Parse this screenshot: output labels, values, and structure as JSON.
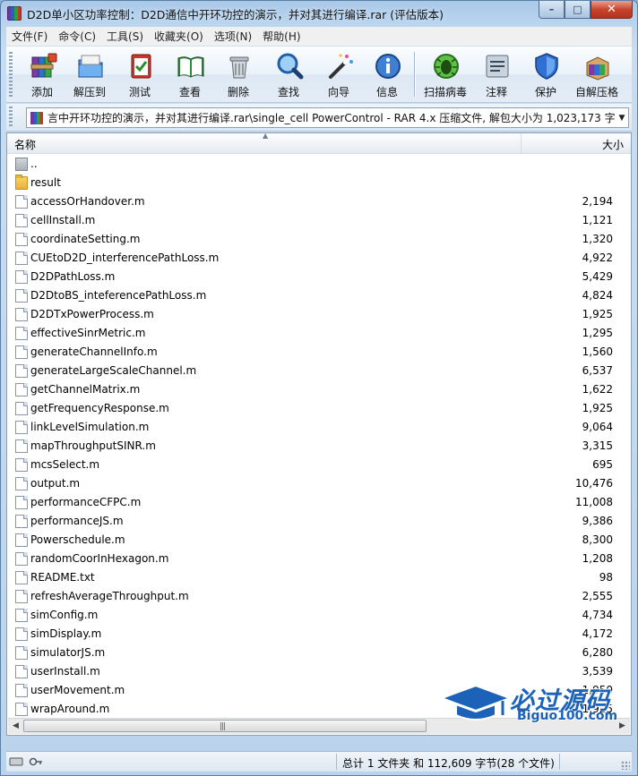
{
  "window": {
    "title": "D2D单小区功率控制：D2D通信中开环功控的演示，并对其进行编译.rar (评估版本)",
    "controls": {
      "minimize": "–",
      "maximize": "□",
      "close": "✕"
    }
  },
  "menu": [
    "文件(F)",
    "命令(C)",
    "工具(S)",
    "收藏夹(O)",
    "选项(N)",
    "帮助(H)"
  ],
  "toolbar": [
    {
      "label": "添加",
      "icon": "add-archive-icon"
    },
    {
      "label": "解压到",
      "icon": "extract-to-icon"
    },
    {
      "label": "测试",
      "icon": "test-icon"
    },
    {
      "label": "查看",
      "icon": "view-icon"
    },
    {
      "label": "删除",
      "icon": "delete-icon"
    },
    {
      "label": "查找",
      "icon": "find-icon"
    },
    {
      "label": "向导",
      "icon": "wizard-icon"
    },
    {
      "label": "信息",
      "icon": "info-icon"
    },
    {
      "label": "扫描病毒",
      "icon": "virus-scan-icon"
    },
    {
      "label": "注释",
      "icon": "comment-icon"
    },
    {
      "label": "保护",
      "icon": "protect-icon"
    },
    {
      "label": "自解压格",
      "icon": "sfx-icon"
    }
  ],
  "address": {
    "path": "言中开环功控的演示，并对其进行编译.rar\\single_cell PowerControl - RAR 4.x 压缩文件, 解包大小为 1,023,173 字节"
  },
  "columns": {
    "name": "名称",
    "size": "大小"
  },
  "files": [
    {
      "name": "..",
      "size": "",
      "type": "up"
    },
    {
      "name": "result",
      "size": "",
      "type": "folder"
    },
    {
      "name": "accessOrHandover.m",
      "size": "2,194",
      "type": "file"
    },
    {
      "name": "cellInstall.m",
      "size": "1,121",
      "type": "file"
    },
    {
      "name": "coordinateSetting.m",
      "size": "1,320",
      "type": "file"
    },
    {
      "name": "CUEtoD2D_interferencePathLoss.m",
      "size": "4,922",
      "type": "file"
    },
    {
      "name": "D2DPathLoss.m",
      "size": "5,429",
      "type": "file"
    },
    {
      "name": "D2DtoBS_inteferencePathLoss.m",
      "size": "4,824",
      "type": "file"
    },
    {
      "name": "D2DTxPowerProcess.m",
      "size": "1,925",
      "type": "file"
    },
    {
      "name": "effectiveSinrMetric.m",
      "size": "1,295",
      "type": "file"
    },
    {
      "name": "generateChannelInfo.m",
      "size": "1,560",
      "type": "file"
    },
    {
      "name": "generateLargeScaleChannel.m",
      "size": "6,537",
      "type": "file"
    },
    {
      "name": "getChannelMatrix.m",
      "size": "1,622",
      "type": "file"
    },
    {
      "name": "getFrequencyResponse.m",
      "size": "1,925",
      "type": "file"
    },
    {
      "name": "linkLevelSimulation.m",
      "size": "9,064",
      "type": "file"
    },
    {
      "name": "mapThroughputSINR.m",
      "size": "3,315",
      "type": "file"
    },
    {
      "name": "mcsSelect.m",
      "size": "695",
      "type": "file"
    },
    {
      "name": "output.m",
      "size": "10,476",
      "type": "file"
    },
    {
      "name": "performanceCFPC.m",
      "size": "11,008",
      "type": "file"
    },
    {
      "name": "performanceJS.m",
      "size": "9,386",
      "type": "file"
    },
    {
      "name": "Powerschedule.m",
      "size": "8,300",
      "type": "file"
    },
    {
      "name": "randomCoorInHexagon.m",
      "size": "1,208",
      "type": "file"
    },
    {
      "name": "README.txt",
      "size": "98",
      "type": "file"
    },
    {
      "name": "refreshAverageThroughput.m",
      "size": "2,555",
      "type": "file"
    },
    {
      "name": "simConfig.m",
      "size": "4,734",
      "type": "file"
    },
    {
      "name": "simDisplay.m",
      "size": "4,172",
      "type": "file"
    },
    {
      "name": "simulatorJS.m",
      "size": "6,280",
      "type": "file"
    },
    {
      "name": "userInstall.m",
      "size": "3,539",
      "type": "file"
    },
    {
      "name": "userMovement.m",
      "size": "1,950",
      "type": "file"
    },
    {
      "name": "wrapAround.m",
      "size": "1,925",
      "type": "file"
    }
  ],
  "status": {
    "summary": "总计 1 文件夹 和 112,609 字节(28 个文件)"
  },
  "watermark": {
    "cn": "必过源码",
    "en": "Biguo100.com"
  }
}
